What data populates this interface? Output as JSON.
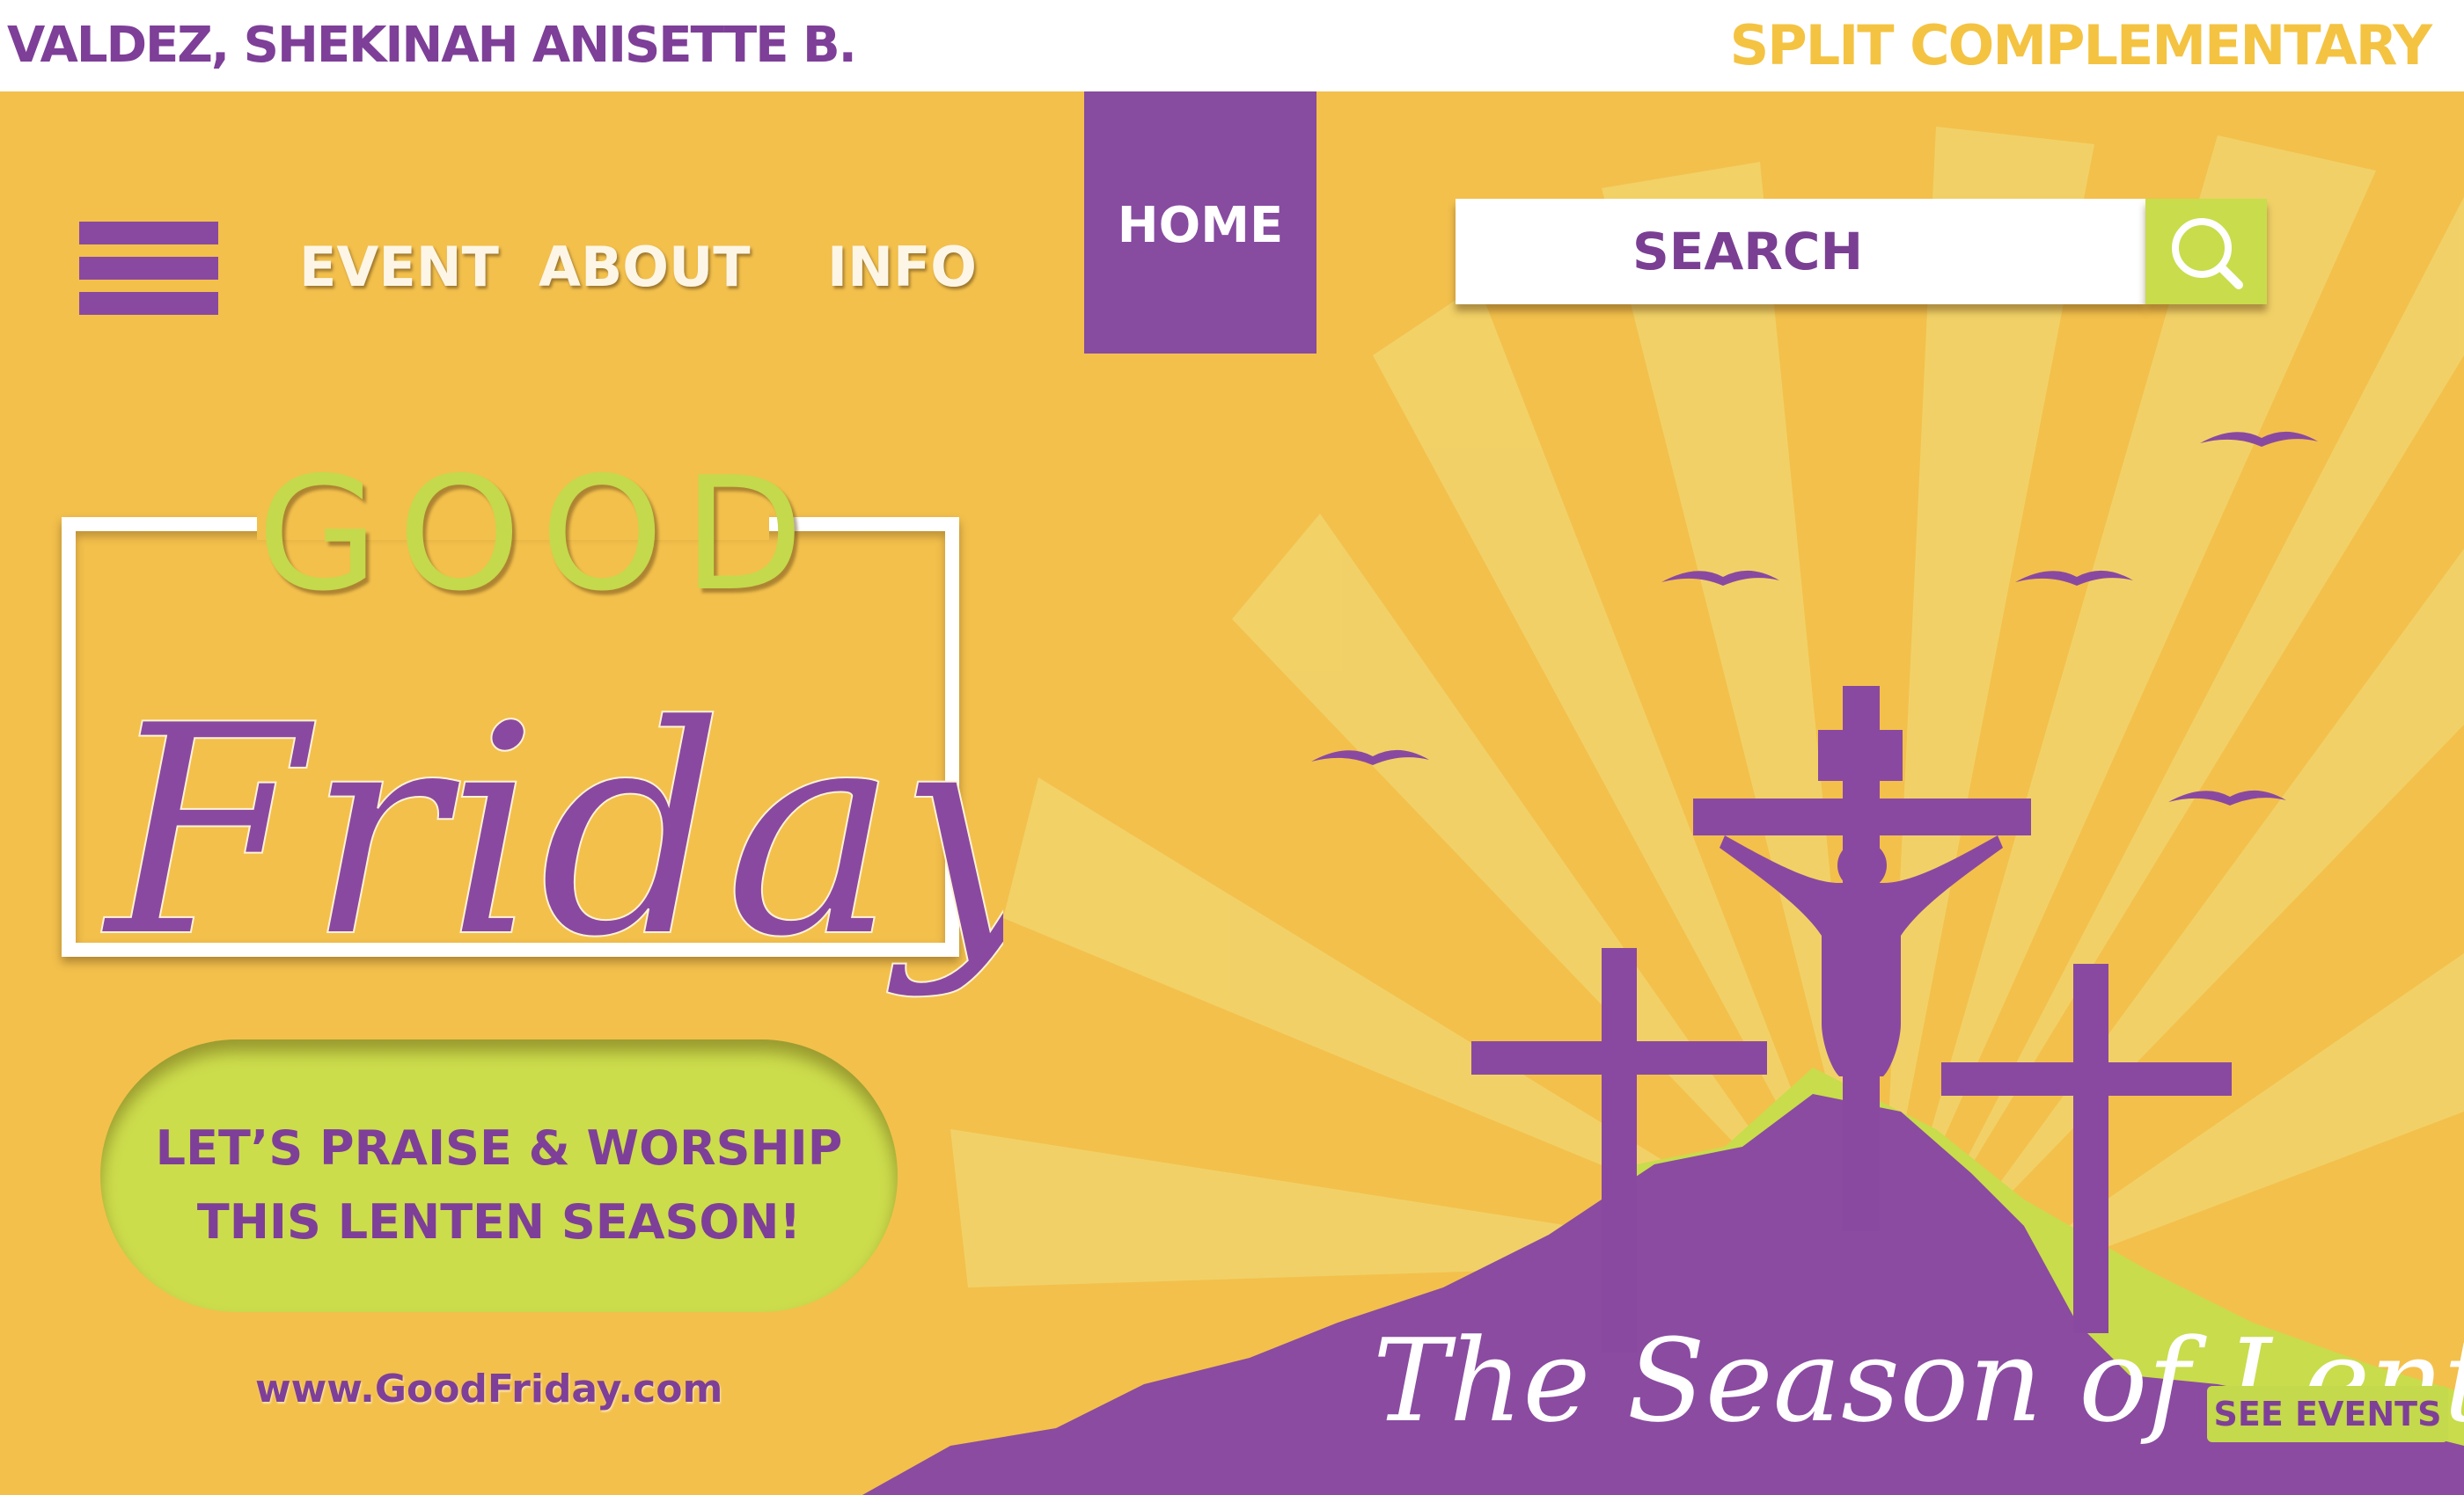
{
  "header": {
    "author": "VALDEZ, SHEKINAH ANISETTE B.",
    "scheme": "SPLIT COMPLEMENTARY"
  },
  "nav": {
    "menu_icon": "hamburger-menu-icon",
    "links": [
      "EVENT",
      "ABOUT",
      "INFO"
    ],
    "home": "HOME",
    "search_placeholder": "SEARCH",
    "search_icon": "magnifier-icon"
  },
  "hero": {
    "title_top": "GOOD",
    "title_script": "Friday",
    "cta_lines": [
      "LET’S PRAISE & WORSHIP",
      "THIS LENTEN SEASON!"
    ],
    "website": "www.GoodFriday.com",
    "tagline": "The Season of Lent",
    "see_events": "SEE EVENTS"
  },
  "colors": {
    "yellow": "#f3c04c",
    "purple": "#874ba0",
    "lime": "#c9dc4b",
    "ray": "#f1d770"
  }
}
